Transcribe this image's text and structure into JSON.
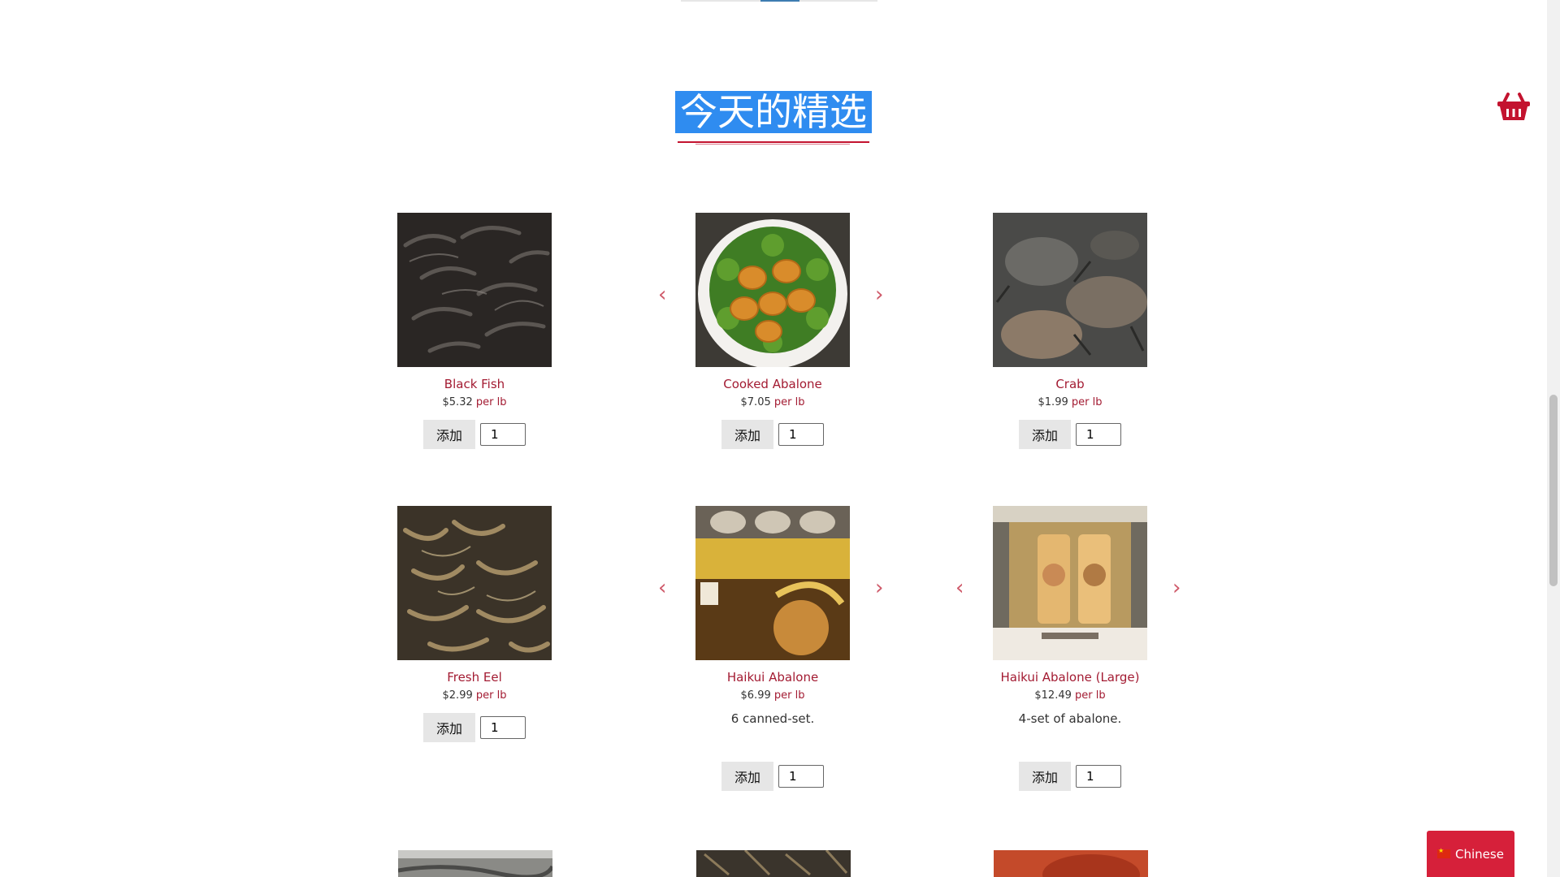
{
  "section": {
    "title": "今天的精选"
  },
  "colors": {
    "accent": "#a31b32",
    "highlight": "#2f8cf0",
    "language_button": "#d6203a"
  },
  "icons": {
    "cart": "basket-icon",
    "prev": "chevron-left-icon",
    "next": "chevron-right-icon"
  },
  "products": [
    {
      "name": "Black Fish",
      "price": "$5.32",
      "unit": "per lb",
      "add_label": "添加",
      "qty": "1"
    },
    {
      "name": "Cooked Abalone",
      "price": "$7.05",
      "unit": "per lb",
      "add_label": "添加",
      "qty": "1"
    },
    {
      "name": "Crab",
      "price": "$1.99",
      "unit": "per lb",
      "add_label": "添加",
      "qty": "1"
    },
    {
      "name": "Fresh Eel",
      "price": "$2.99",
      "unit": "per lb",
      "add_label": "添加",
      "qty": "1"
    },
    {
      "name": "Haikui Abalone",
      "price": "$6.99",
      "unit": "per lb",
      "description": "6 canned-set.",
      "add_label": "添加",
      "qty": "1"
    },
    {
      "name": "Haikui Abalone (Large)",
      "price": "$12.49",
      "unit": "per lb",
      "description": "4-set of abalone.",
      "add_label": "添加",
      "qty": "1"
    }
  ],
  "language": {
    "label": "Chinese"
  }
}
